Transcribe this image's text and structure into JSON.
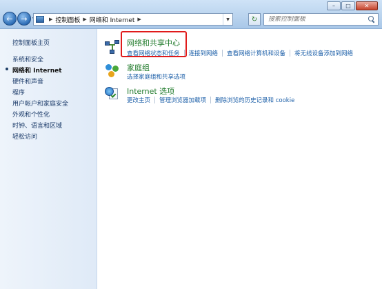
{
  "window": {
    "minimize_label": "–",
    "maximize_label": "□",
    "close_label": "✕",
    "controls_close_color": "#c6442c"
  },
  "nav": {
    "back_icon": "back-arrow-icon",
    "forward_icon": "forward-arrow-icon",
    "back_label": "←",
    "forward_label": "→"
  },
  "address": {
    "crumbs": [
      "控制面板",
      "网络和 Internet"
    ],
    "refresh_label": "↻"
  },
  "search": {
    "placeholder": "搜索控制面板"
  },
  "sidebar": {
    "items": [
      {
        "label": "控制面板主页",
        "current": false
      },
      {
        "label": "系统和安全",
        "current": false
      },
      {
        "label": "网络和 Internet",
        "current": true
      },
      {
        "label": "硬件和声音",
        "current": false
      },
      {
        "label": "程序",
        "current": false
      },
      {
        "label": "用户帐户和家庭安全",
        "current": false
      },
      {
        "label": "外观和个性化",
        "current": false
      },
      {
        "label": "时钟、语言和区域",
        "current": false
      },
      {
        "label": "轻松访问",
        "current": false
      }
    ]
  },
  "categories": [
    {
      "title": "网络和共享中心",
      "icon": "network-icon",
      "links": [
        "查看网络状态和任务",
        "连接到网络",
        "查看网络计算机和设备",
        "将无线设备添加到网络"
      ]
    },
    {
      "title": "家庭组",
      "icon": "homegroup-icon",
      "links": [
        "选择家庭组和共享选项"
      ]
    },
    {
      "title": "Internet 选项",
      "icon": "internet-options-icon",
      "links": [
        "更改主页",
        "管理浏览器加载项",
        "删除浏览的历史记录和 cookie"
      ]
    }
  ],
  "colors": {
    "link": "#1c5fa8",
    "category_title": "#1f7a2a",
    "highlight": "#e01b1b",
    "sidebar_text": "#1e3d6b"
  }
}
